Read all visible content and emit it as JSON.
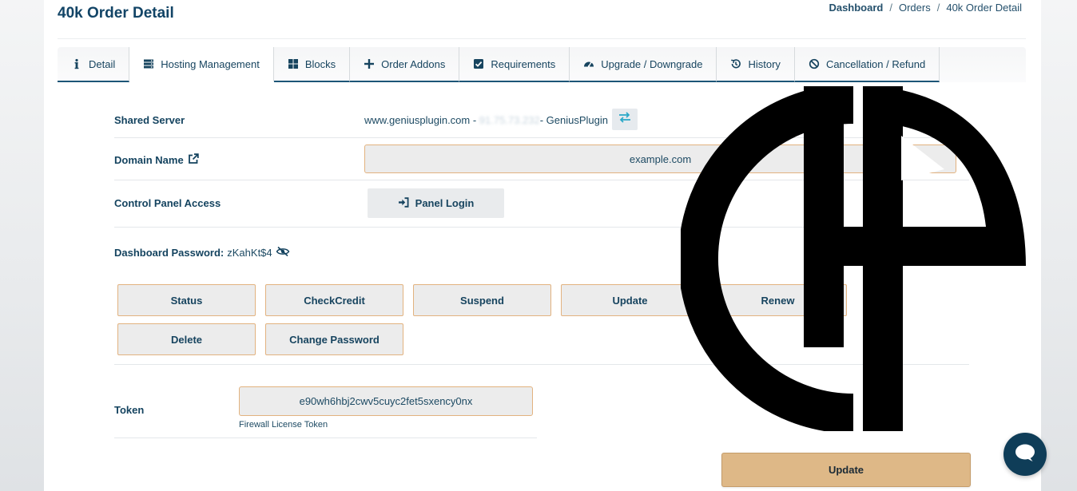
{
  "page": {
    "title": "40k Order Detail"
  },
  "breadcrumb": {
    "items": [
      "Dashboard",
      "Orders",
      "40k Order Detail"
    ],
    "separator": "/"
  },
  "tabs": [
    {
      "label": "Detail",
      "icon": "info-icon"
    },
    {
      "label": "Hosting Management",
      "icon": "server-icon",
      "active": true
    },
    {
      "label": "Blocks",
      "icon": "grid-icon"
    },
    {
      "label": "Order Addons",
      "icon": "plus-icon"
    },
    {
      "label": "Requirements",
      "icon": "check-square-icon"
    },
    {
      "label": "Upgrade / Downgrade",
      "icon": "gauge-icon"
    },
    {
      "label": "History",
      "icon": "history-icon"
    },
    {
      "label": "Cancellation / Refund",
      "icon": "ban-icon"
    }
  ],
  "hosting": {
    "shared_server_label": "Shared Server",
    "server_host": "www.geniusplugin.com - ",
    "server_ip": "91.75.73.232",
    "server_name": "- GeniusPlugin",
    "domain_label": "Domain Name",
    "domain_value": "example.com",
    "control_panel_label": "Control Panel Access",
    "panel_login_label": "Panel Login",
    "dashboard_password_label": "Dashboard Password:",
    "dashboard_password_value": "zKahKt$4"
  },
  "actions": [
    {
      "label": "Status"
    },
    {
      "label": "CheckCredit"
    },
    {
      "label": "Suspend"
    },
    {
      "label": "Update"
    },
    {
      "label": "Renew"
    },
    {
      "label": "Delete"
    },
    {
      "label": "Change Password"
    }
  ],
  "token": {
    "label": "Token",
    "value": "e90wh6hbj2cwv5cuyc2fet5sxency0nx",
    "help": "Firewall License Token"
  },
  "footer": {
    "update_label": "Update"
  },
  "colors": {
    "primary": "#124466",
    "accent_border": "#e2b27f",
    "update_button": "#deb887",
    "swap_icon": "#2aa8c8",
    "chat_button": "#0f3d58"
  }
}
